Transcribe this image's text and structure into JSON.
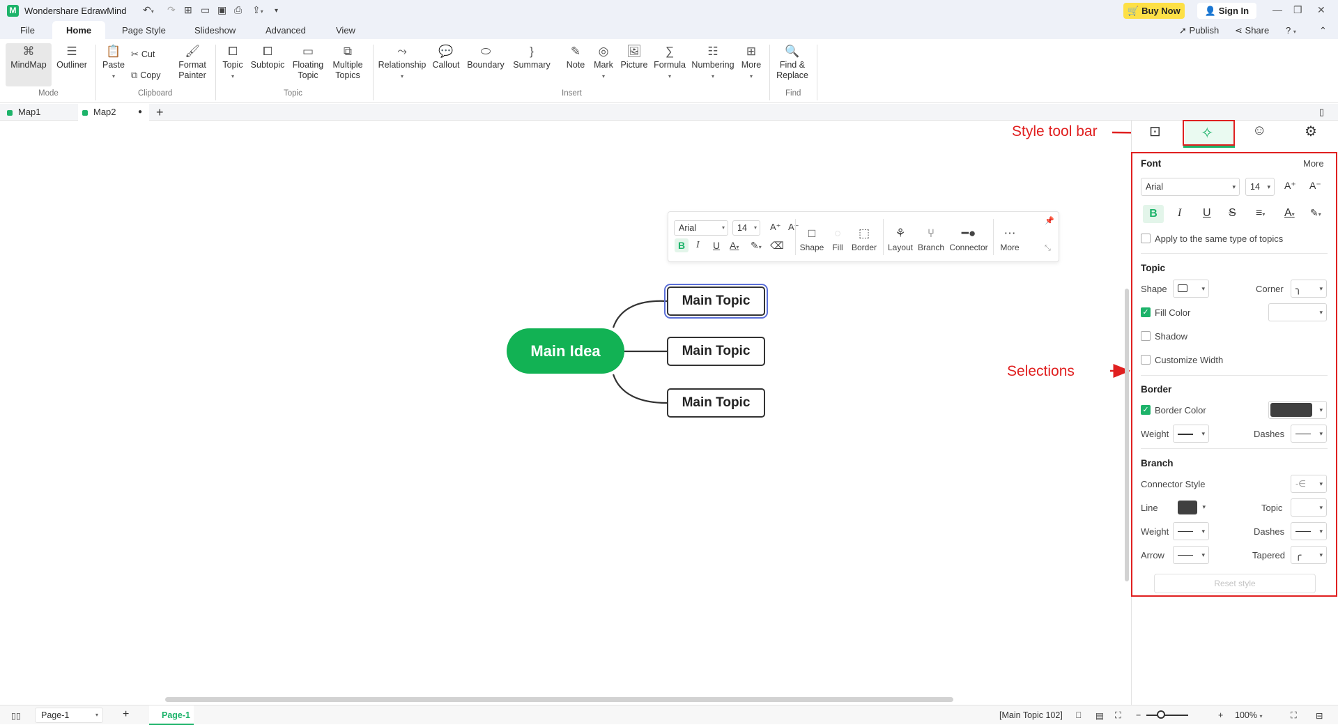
{
  "app": {
    "title": "Wondershare EdrawMind",
    "buy_now": "Buy Now",
    "sign_in": "Sign In",
    "publish": "Publish",
    "share": "Share",
    "help": "?"
  },
  "menu": {
    "tabs": [
      "File",
      "Home",
      "Page Style",
      "Slideshow",
      "Advanced",
      "View"
    ]
  },
  "ribbon": {
    "mode": {
      "mindmap": "MindMap",
      "outliner": "Outliner",
      "group": "Mode"
    },
    "clipboard": {
      "paste": "Paste",
      "cut": "Cut",
      "copy": "Copy",
      "format_painter_1": "Format",
      "format_painter_2": "Painter",
      "group": "Clipboard"
    },
    "topic": {
      "topic": "Topic",
      "subtopic": "Subtopic",
      "floating_1": "Floating",
      "floating_2": "Topic",
      "multiple_1": "Multiple",
      "multiple_2": "Topics",
      "group": "Topic"
    },
    "insert": {
      "relationship": "Relationship",
      "callout": "Callout",
      "boundary": "Boundary",
      "summary": "Summary",
      "note": "Note",
      "mark": "Mark",
      "picture": "Picture",
      "formula": "Formula",
      "numbering": "Numbering",
      "more": "More",
      "group": "Insert"
    },
    "find": {
      "find_1": "Find &",
      "find_2": "Replace",
      "group": "Find"
    }
  },
  "doc_tabs": [
    "Map1",
    "Map2"
  ],
  "float_toolbar": {
    "font": "Arial",
    "size": "14",
    "shape": "Shape",
    "fill": "Fill",
    "border": "Border",
    "layout": "Layout",
    "branch": "Branch",
    "connector": "Connector",
    "more": "More"
  },
  "mindmap": {
    "main_idea": "Main Idea",
    "topics": [
      "Main Topic",
      "Main Topic",
      "Main Topic"
    ],
    "main_color": "#12b254"
  },
  "annotations": {
    "style_toolbar": "Style tool bar",
    "selections": "Selections"
  },
  "panel": {
    "font": {
      "title": "Font",
      "more": "More",
      "family": "Arial",
      "size": "14",
      "apply_same": "Apply to the same type of topics"
    },
    "topic": {
      "title": "Topic",
      "shape": "Shape",
      "corner": "Corner",
      "fill_color": "Fill Color",
      "shadow": "Shadow",
      "customize_width": "Customize Width"
    },
    "border": {
      "title": "Border",
      "border_color": "Border Color",
      "weight": "Weight",
      "dashes": "Dashes"
    },
    "branch": {
      "title": "Branch",
      "connector_style": "Connector Style",
      "line": "Line",
      "topic": "Topic",
      "weight": "Weight",
      "dashes": "Dashes",
      "arrow": "Arrow",
      "tapered": "Tapered",
      "reset": "Reset style"
    }
  },
  "status": {
    "page_select": "Page-1",
    "page_tab": "Page-1",
    "selection_info": "[Main Topic 102]",
    "zoom": "100%"
  }
}
